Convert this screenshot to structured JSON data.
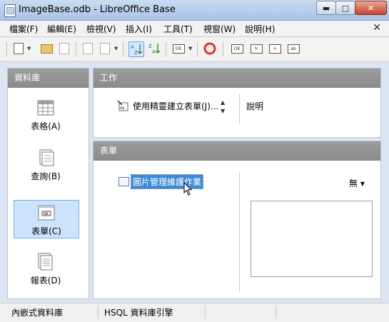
{
  "window": {
    "title": "ImageBase.odb - LibreOffice Base",
    "minimize_label": "▬",
    "maximize_label": "□",
    "close_label": "✕"
  },
  "menubar": {
    "items": [
      "檔案(F)",
      "編輯(E)",
      "檢視(V)",
      "插入(I)",
      "工具(T)",
      "視窗(W)",
      "說明(H)"
    ],
    "close_label": "✕"
  },
  "toolbar": {
    "icons": [
      "new-document-icon",
      "open-icon",
      "save-icon",
      "copy-icon",
      "paste-icon",
      "sort-ascending-icon",
      "sort-descending-icon",
      "form-icon",
      "help-icon",
      "open-form-icon",
      "edit-form-icon",
      "delete-form-icon",
      "rename-form-icon"
    ]
  },
  "sidebar": {
    "header": "資料庫",
    "items": [
      {
        "label": "表格(A)",
        "icon": "table-icon",
        "selected": false
      },
      {
        "label": "查詢(B)",
        "icon": "query-icon",
        "selected": false
      },
      {
        "label": "表單(C)",
        "icon": "form-icon",
        "selected": true
      },
      {
        "label": "報表(D)",
        "icon": "report-icon",
        "selected": false
      }
    ]
  },
  "tasks": {
    "header": "工作",
    "item_label": "使用精靈建立表單(J)...",
    "description_label": "說明"
  },
  "forms": {
    "header": "表單",
    "selected_item": "圖片管理維護作業",
    "preview_value": "無",
    "preview_arrow": "▾"
  },
  "statusbar": {
    "segments": [
      "內嵌式資料庫",
      "HSQL 資料庫引擎"
    ]
  },
  "colors": {
    "selection": "#3c8ad6",
    "panel_header": "#9c9c9c",
    "nav_selected": "#cce4fb"
  }
}
